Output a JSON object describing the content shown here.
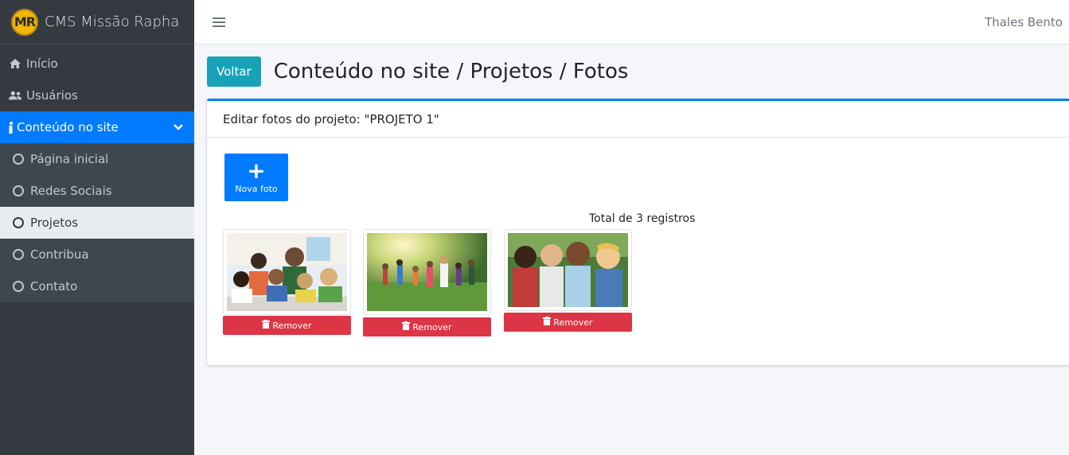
{
  "brand": {
    "logo_text": "MR",
    "title": "CMS Missão Rapha"
  },
  "topbar": {
    "user": "Thales Bento"
  },
  "sidebar": {
    "items": [
      {
        "label": "Início",
        "icon": "home-icon"
      },
      {
        "label": "Usuários",
        "icon": "users-icon"
      },
      {
        "label": "Conteúdo no site",
        "icon": "info-icon",
        "active": true
      }
    ],
    "subitems": [
      {
        "label": "Página inicial"
      },
      {
        "label": "Redes Sociais"
      },
      {
        "label": "Projetos",
        "current": true
      },
      {
        "label": "Contribua"
      },
      {
        "label": "Contato"
      }
    ]
  },
  "header": {
    "back_label": "Voltar",
    "title": "Conteúdo no site / Projetos / Fotos"
  },
  "card": {
    "title": "Editar fotos do projeto: \"PROJETO 1\"",
    "new_photo_label": "Nova foto",
    "total_text": "Total de 3 registros",
    "remove_label": "Remover"
  },
  "colors": {
    "primary": "#007bff",
    "info": "#17a2b8",
    "danger": "#dc3545",
    "sidebar": "#343a40"
  }
}
